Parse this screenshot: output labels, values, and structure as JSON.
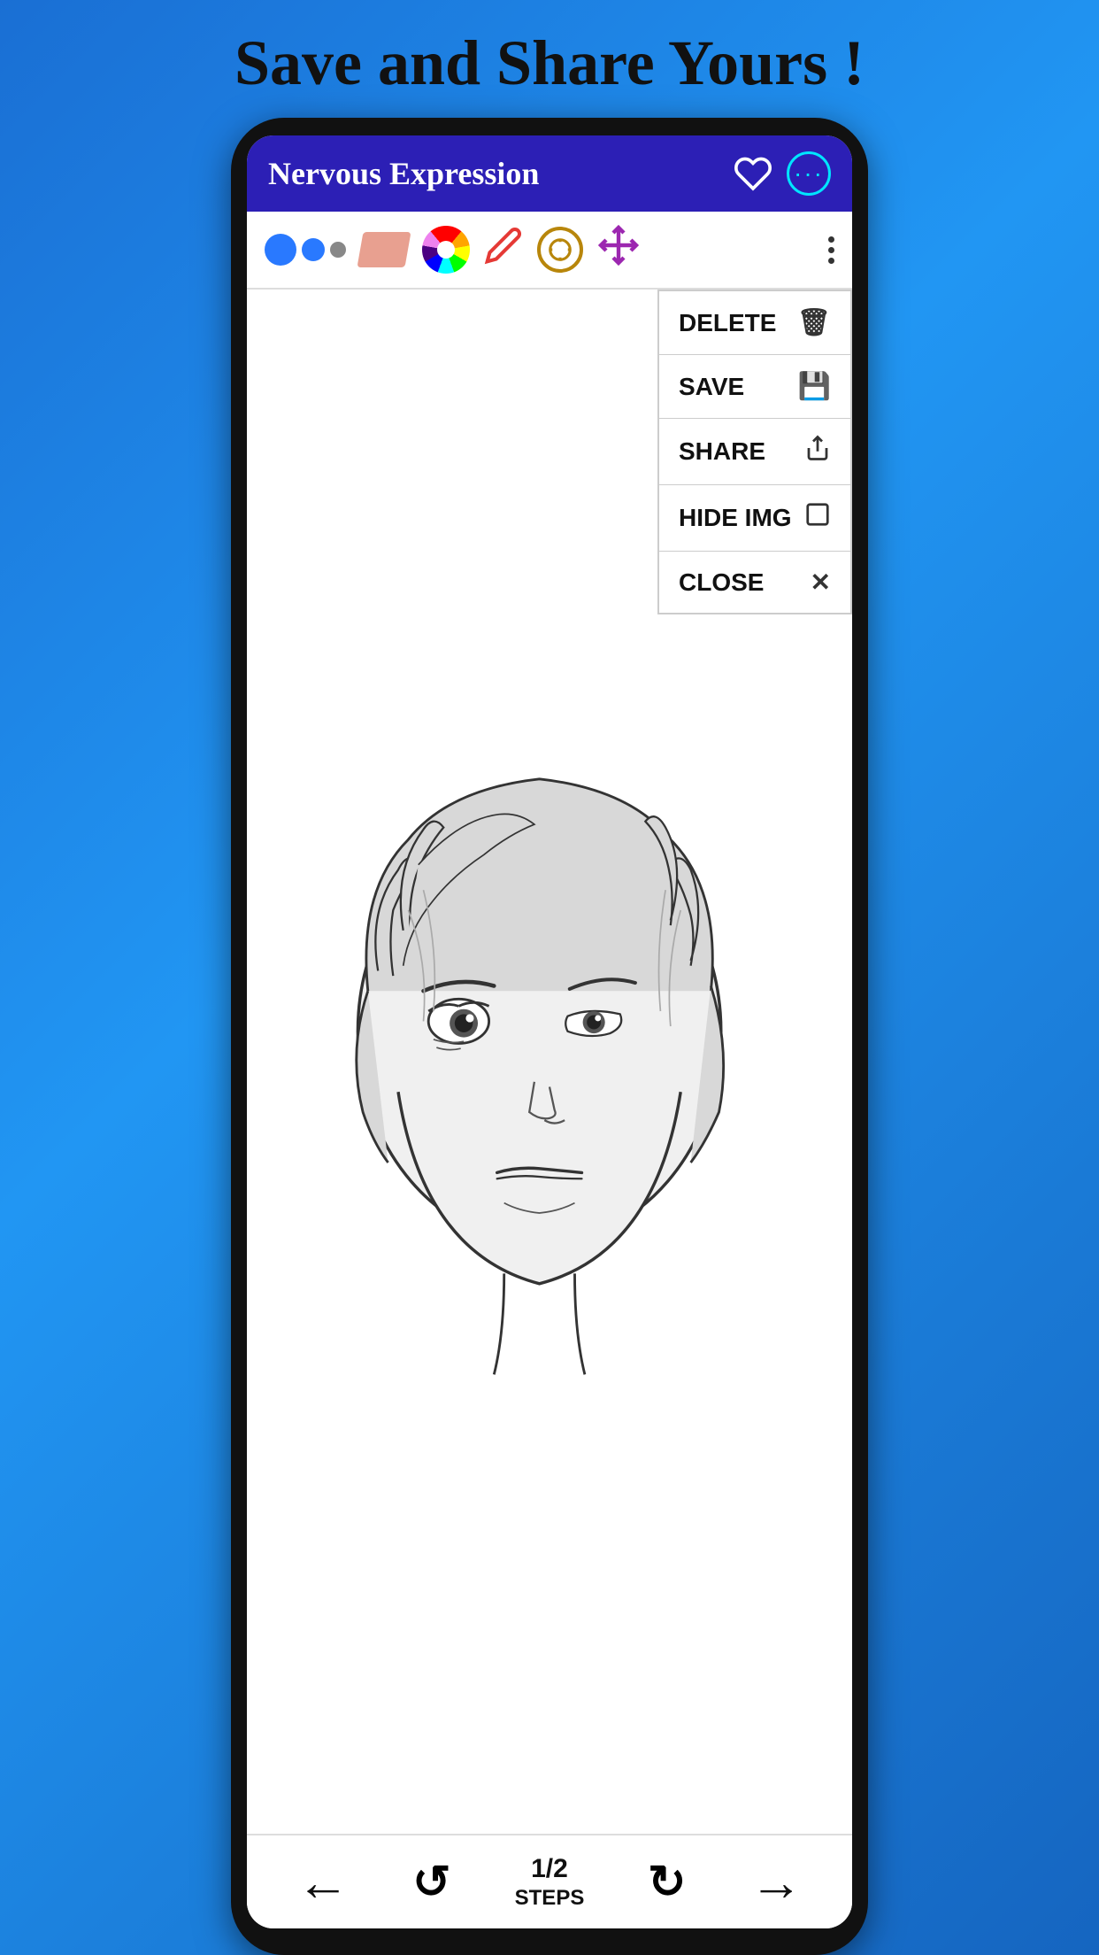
{
  "page": {
    "top_label": "Save and Share Yours !"
  },
  "header": {
    "title": "Nervous Expression",
    "heart_icon": "heart-icon",
    "more_icon": "more-circle-icon"
  },
  "toolbar": {
    "brush_label": "brush-tool",
    "eraser_label": "eraser-tool",
    "color_wheel_label": "color-wheel-tool",
    "pencil_label": "pencil-tool",
    "select_label": "select-tool",
    "move_label": "move-tool",
    "more_label": "more-options"
  },
  "dropdown_menu": {
    "items": [
      {
        "label": "DELETE",
        "icon": "trash-icon"
      },
      {
        "label": "SAVE",
        "icon": "save-icon"
      },
      {
        "label": "SHARE",
        "icon": "share-icon"
      },
      {
        "label": "HIDE IMG",
        "icon": "hide-icon"
      },
      {
        "label": "CLOSE",
        "icon": "close-icon"
      }
    ]
  },
  "bottom_nav": {
    "back_arrow": "←",
    "forward_arrow": "→",
    "replay_left": "↺",
    "replay_right": "↻",
    "steps_fraction": "1/2",
    "steps_label": "STEPS"
  }
}
